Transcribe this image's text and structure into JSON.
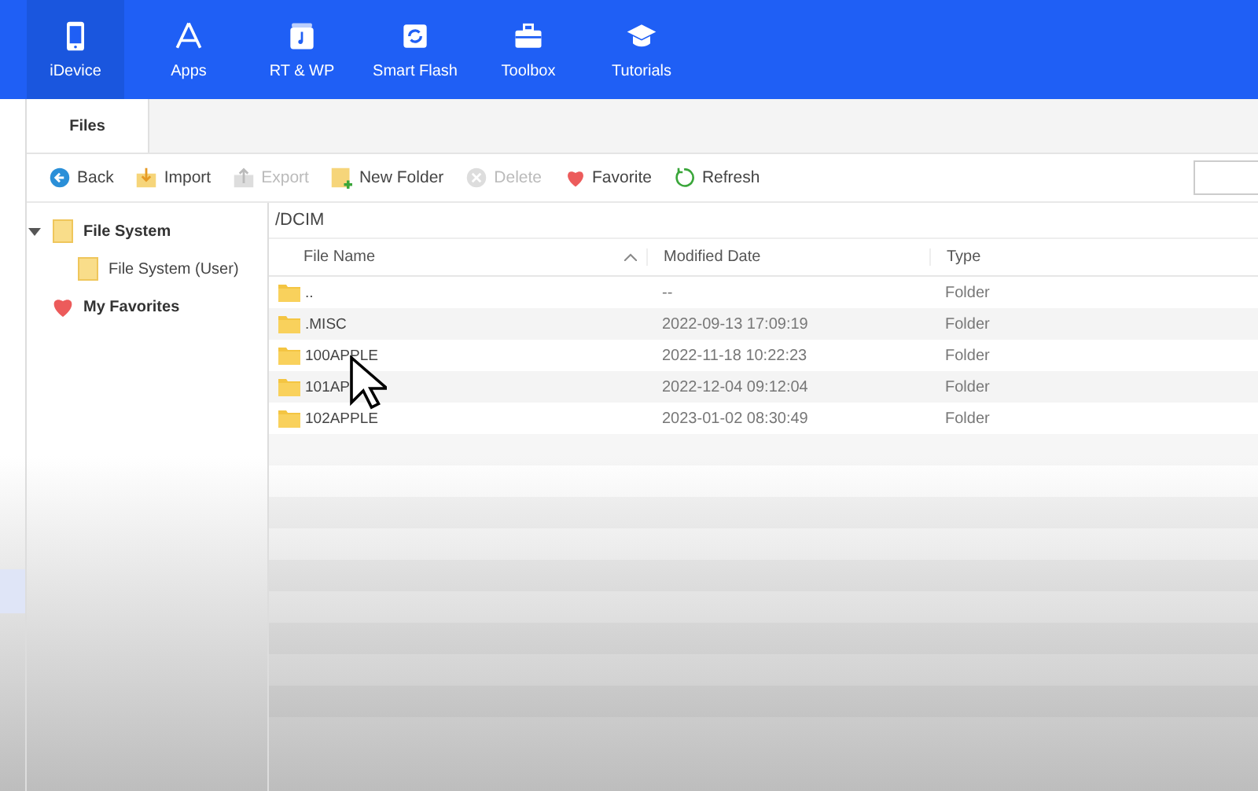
{
  "nav": [
    {
      "label": "iDevice",
      "selected": true
    },
    {
      "label": "Apps",
      "selected": false
    },
    {
      "label": "RT & WP",
      "selected": false
    },
    {
      "label": "Smart Flash",
      "selected": false
    },
    {
      "label": "Toolbox",
      "selected": false
    },
    {
      "label": "Tutorials",
      "selected": false
    }
  ],
  "tabs": [
    {
      "label": "Files",
      "selected": true
    }
  ],
  "toolbar": [
    {
      "label": "Back",
      "disabled": false
    },
    {
      "label": "Import",
      "disabled": false
    },
    {
      "label": "Export",
      "disabled": true
    },
    {
      "label": "New Folder",
      "disabled": false
    },
    {
      "label": "Delete",
      "disabled": true
    },
    {
      "label": "Favorite",
      "disabled": false
    },
    {
      "label": "Refresh",
      "disabled": false
    }
  ],
  "tree": [
    {
      "label": "File System",
      "expanded": true,
      "children": [
        {
          "label": "File System (User)"
        }
      ]
    },
    {
      "label": "My Favorites"
    }
  ],
  "path": "/DCIM",
  "table": {
    "columns": [
      "File Name",
      "Modified Date",
      "Type"
    ],
    "rows": [
      {
        "name": "..",
        "date": "--",
        "type": "Folder"
      },
      {
        "name": ".MISC",
        "date": "2022-09-13 17:09:19",
        "type": "Folder"
      },
      {
        "name": "100APPLE",
        "date": "2022-11-18 10:22:23",
        "type": "Folder"
      },
      {
        "name": "101AP",
        "date": "2022-12-04 09:12:04",
        "type": "Folder"
      },
      {
        "name": "102APPLE",
        "date": "2023-01-02 08:30:49",
        "type": "Folder"
      }
    ]
  }
}
